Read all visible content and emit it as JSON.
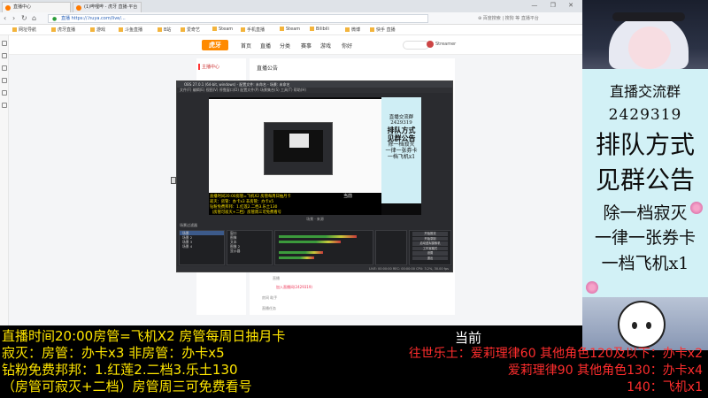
{
  "browser": {
    "tabs": [
      "直播中心",
      "(1)哔哩哔 - 虎牙 直播·平台"
    ],
    "window_controls": "— ❐ ✕",
    "url": "直播 https://.huya.com/live/...",
    "url_right": "⊕ 百度搜索 | 搜狗 等 直播平台",
    "bookmarks": [
      "网址导航",
      "虎牙直播",
      "游戏",
      "斗鱼直播",
      "B站",
      "爱奇艺",
      "Steam",
      "手机直播",
      "Steam",
      "Bilibili",
      "微博",
      "快手 直播"
    ],
    "site_nav": [
      "首页",
      "直播",
      "分类",
      "赛事",
      "游戏",
      "你好"
    ],
    "logo_text": "虎牙",
    "user_name": "Streamer",
    "side_title": "主播中心",
    "main_title": "直播公告",
    "form_label_1": "直播",
    "form_link": "加入直播间(2429319)",
    "form_label_2": "房间 助手",
    "form_label_3": "直播任务"
  },
  "obs": {
    "title": "OBS 27.0.1 (64-bit, windows) - 配置文件: 未命名 - 场景: 未命名",
    "menu": "文件(F)  编辑(E)  视图(V)  停靠窗口(D)  配置文件(P)  场景集合(S)  工具(T)  帮助(H)",
    "toolbar": "场景 · 来源",
    "dock_title": "场景过滤器",
    "scenes": [
      "场景",
      "场景 2",
      "场景 3",
      "场景 4"
    ],
    "sources": [
      "窗口",
      "图像",
      "文本",
      "图像 2",
      "显示器"
    ],
    "controls": [
      "开始推流",
      "开始录制",
      "启动虚拟摄像机",
      "工作室模式",
      "设置",
      "退出"
    ],
    "status": "LIVE: 00:00:00   REC: 00:00:00   CPU: 3.2%, 30.00 fps"
  },
  "notice_panel": {
    "line1": "直播交流群",
    "line2": "2429319",
    "line3": "排队方式",
    "line4": "见群公告",
    "line5": "除一档寂灭",
    "line6": "一律一张券卡",
    "line7": "一档飞机x1"
  },
  "overlay": {
    "left_lines": [
      "直播时间20:00房管=飞机X2 房管每周日抽月卡",
      "寂灭：房管：办卡x3 非房管：办卡x5",
      "钻粉免费邦邦：1.红莲2.二档3.乐土130",
      "（房管可寂灭+二档）房管周三可免费看号"
    ],
    "now_label": "当前",
    "right_lines": [
      "往世乐土：爱莉理律60 其他角色120及以下：办卡x2",
      "爱莉理律90 其他角色130：办卡x4",
      "140：飞机x1"
    ]
  },
  "colors": {
    "overlay_yellow": "#ffe600",
    "overlay_red": "#ff2d2d",
    "notice_bg": "#d2f1f6",
    "brand_orange": "#ff8a00"
  }
}
